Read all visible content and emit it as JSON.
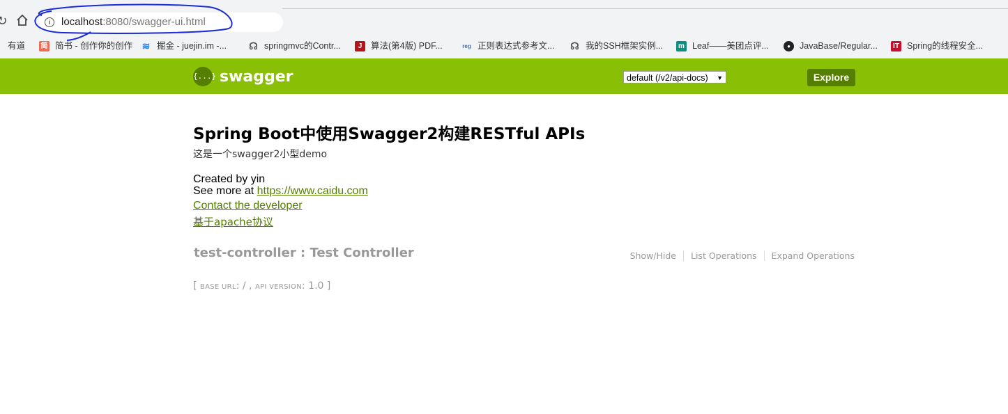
{
  "browser": {
    "url_host": "localhost",
    "url_path": ":8080/swagger-ui.html",
    "bookmarks": [
      {
        "label": "有道",
        "icon": "youdao-icon",
        "color": "#d9241f"
      },
      {
        "label": "简书 - 创作你的创作",
        "icon": "jianshu-icon",
        "color": "#ea6f5a"
      },
      {
        "label": "掘金 - juejin.im -...",
        "icon": "juejin-icon",
        "color": "#1e80ff"
      },
      {
        "label": "springmvc的Contr...",
        "icon": "bookmark-icon",
        "color": "#555555"
      },
      {
        "label": "算法(第4版) PDF...",
        "icon": "j-icon",
        "color": "#b5161b"
      },
      {
        "label": "正则表达式参考文...",
        "icon": "regex-icon",
        "color": "#4a6aa5"
      },
      {
        "label": "我的SSH框架实例...",
        "icon": "bookmark-icon",
        "color": "#555555"
      },
      {
        "label": "Leaf——美团点评...",
        "icon": "m-icon",
        "color": "#0d8f7f"
      },
      {
        "label": "JavaBase/Regular...",
        "icon": "github-icon",
        "color": "#222222"
      },
      {
        "label": "Spring的线程安全...",
        "icon": "it-icon",
        "color": "#c8102e"
      }
    ]
  },
  "header": {
    "logo_text": "swagger",
    "logo_badge": "{...}",
    "api_select": "default (/v2/api-docs)",
    "explore_label": "Explore",
    "bar_color": "#89bf04"
  },
  "info": {
    "title": "Spring Boot中使用Swagger2构建RESTful APIs",
    "description": "这是一个swagger2小型demo",
    "created_by": "Created by yin",
    "see_more_prefix": "See more at ",
    "see_more_link": "https://www.caidu.com",
    "contact": "Contact the developer",
    "license": "基于apache协议"
  },
  "resource": {
    "heading": "test-controller : Test Controller",
    "ops": [
      "Show/Hide",
      "List Operations",
      "Expand Operations"
    ]
  },
  "footer": {
    "open": "[ ",
    "base_url_label": "base url",
    "base_url_value": ": / , ",
    "api_version_label": "api version",
    "api_version_value": ": 1.0 ]"
  }
}
